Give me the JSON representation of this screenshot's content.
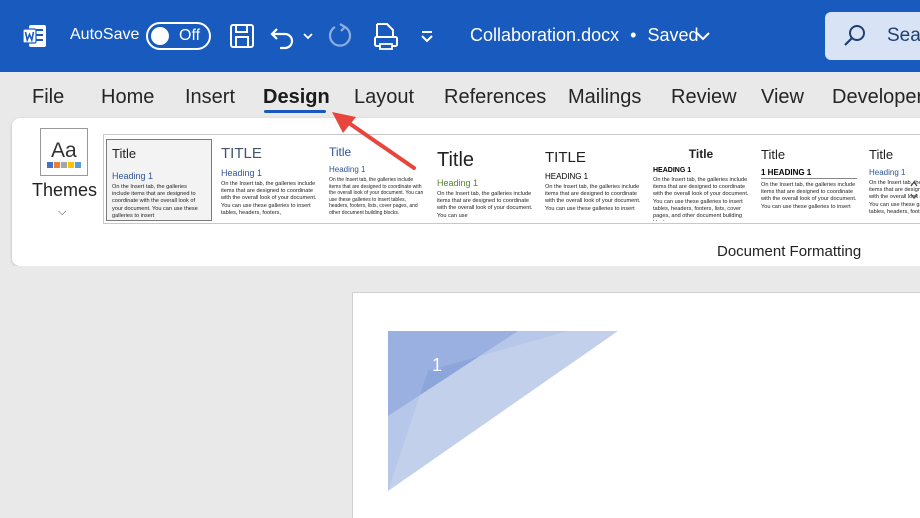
{
  "titlebar": {
    "autosave_label": "AutoSave",
    "autosave_state": "Off",
    "doc_title": "Collaboration.docx",
    "separator": "•",
    "save_status": "Saved",
    "search_label": "Search",
    "icons": [
      "word-logo-icon",
      "save-icon",
      "undo-icon",
      "undo-dropdown-icon",
      "redo-icon",
      "print-preview-icon",
      "customize-toolbar-icon",
      "title-dropdown-icon",
      "search-icon"
    ]
  },
  "tabs": {
    "items": [
      {
        "label": "File"
      },
      {
        "label": "Home"
      },
      {
        "label": "Insert"
      },
      {
        "label": "Design"
      },
      {
        "label": "Layout"
      },
      {
        "label": "References"
      },
      {
        "label": "Mailings"
      },
      {
        "label": "Review"
      },
      {
        "label": "View"
      },
      {
        "label": "Developer"
      }
    ],
    "active": "Design"
  },
  "ribbon": {
    "themes_label": "Themes",
    "themes_icon_text": "Aa",
    "group_label": "Document Formatting",
    "styles": [
      {
        "title": "Title",
        "heading": "Heading 1",
        "heading_color": "#2f5496",
        "body": "On the Insert tab, the galleries include items that are designed to coordinate with the overall look of your document. You can use these galleries to insert"
      },
      {
        "title": "TITLE",
        "heading": "Heading 1",
        "heading_color": "#2f5496",
        "body": "On the Insert tab, the galleries include items that are designed to coordinate with the overall look of your document. You can use these galleries to insert tables, headers, footers,"
      },
      {
        "title": "Title",
        "heading": "Heading 1",
        "heading_color": "#2f5496",
        "body": "On the Insert tab, the galleries include items that are designed to coordinate with the overall look of your document. You can use these galleries to insert tables, headers, footers, lists, cover pages, and other document building blocks."
      },
      {
        "title": "Title",
        "heading": "Heading 1",
        "heading_color": "#538135",
        "body": "On the Insert tab, the galleries include items that are designed to coordinate with the overall look of your document. You can use"
      },
      {
        "title": "TITLE",
        "heading": "HEADING 1",
        "heading_color": "#222222",
        "body": "On the Insert tab, the galleries include items that are designed to coordinate with the overall look of your document. You can use these galleries to insert"
      },
      {
        "title": "Title",
        "heading": "HEADING 1",
        "heading_color": "#222222",
        "body": "On the Insert tab, the galleries include items that are designed to coordinate with the overall look of your document. You can use these galleries to insert tables, headers, footers, lists, cover pages, and other document building blocks."
      },
      {
        "title": "Title",
        "heading": "1   HEADING 1",
        "heading_color": "#222222",
        "body": "On the Insert tab, the galleries include items that are designed to coordinate with the overall look of your document. You can use these galleries to insert"
      },
      {
        "title": "Title",
        "heading": "Heading 1",
        "heading_color": "#2f5496",
        "body": "On the Insert tab, the galleries include items that are designed to coordinate with the overall look of your document. You can use these galleries to insert tables, headers, footers,"
      }
    ]
  },
  "document": {
    "page_number": "1"
  },
  "colors": {
    "brand": "#185abd",
    "tab_underline": "#185abd",
    "arrow": "#e8453c"
  }
}
